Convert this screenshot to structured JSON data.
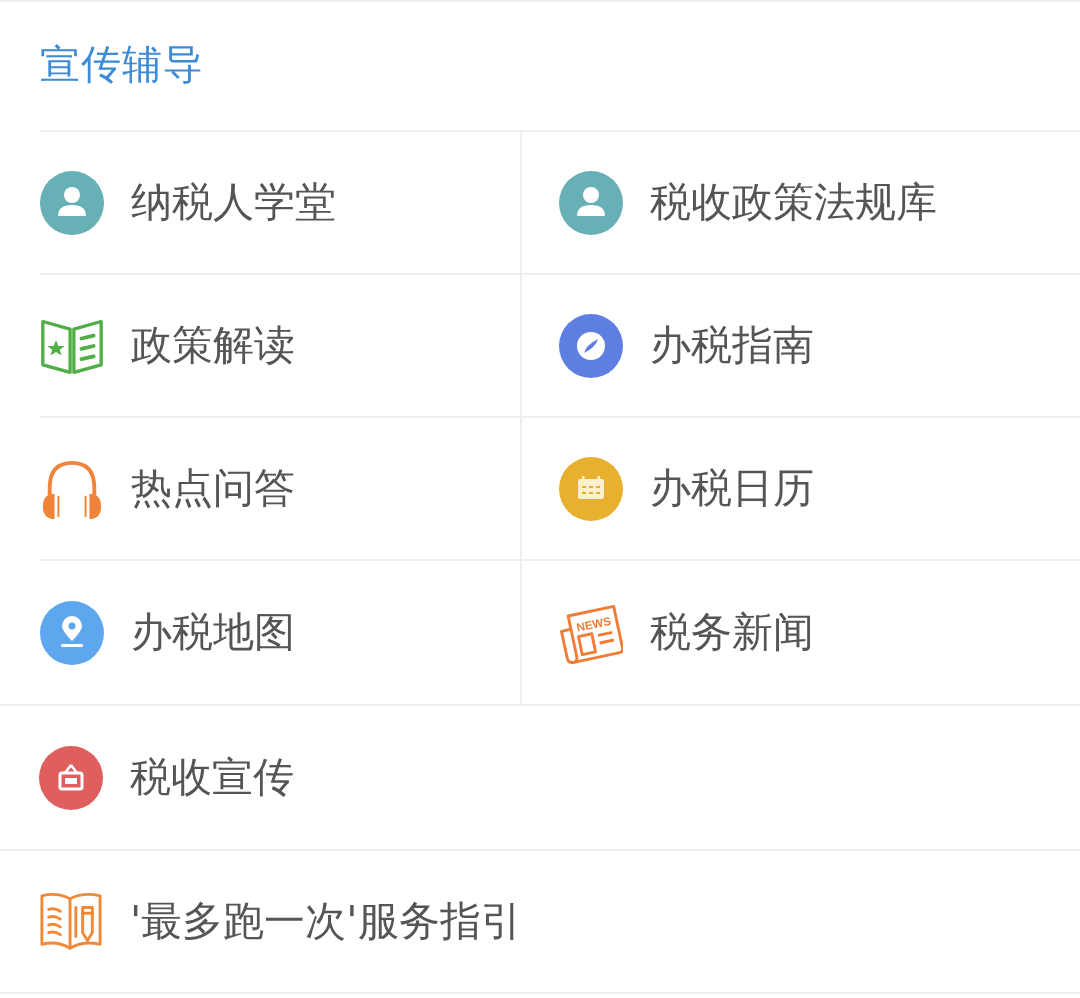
{
  "section": {
    "title": "宣传辅导"
  },
  "grid_items": [
    {
      "label": "纳税人学堂"
    },
    {
      "label": "税收政策法规库"
    },
    {
      "label": "政策解读"
    },
    {
      "label": "办税指南"
    },
    {
      "label": "热点问答"
    },
    {
      "label": "办税日历"
    },
    {
      "label": "办税地图"
    },
    {
      "label": "税务新闻",
      "icon_text": "NEWS"
    }
  ],
  "list_items": [
    {
      "label": "税收宣传"
    },
    {
      "label": "'最多跑一次'服务指引"
    }
  ]
}
